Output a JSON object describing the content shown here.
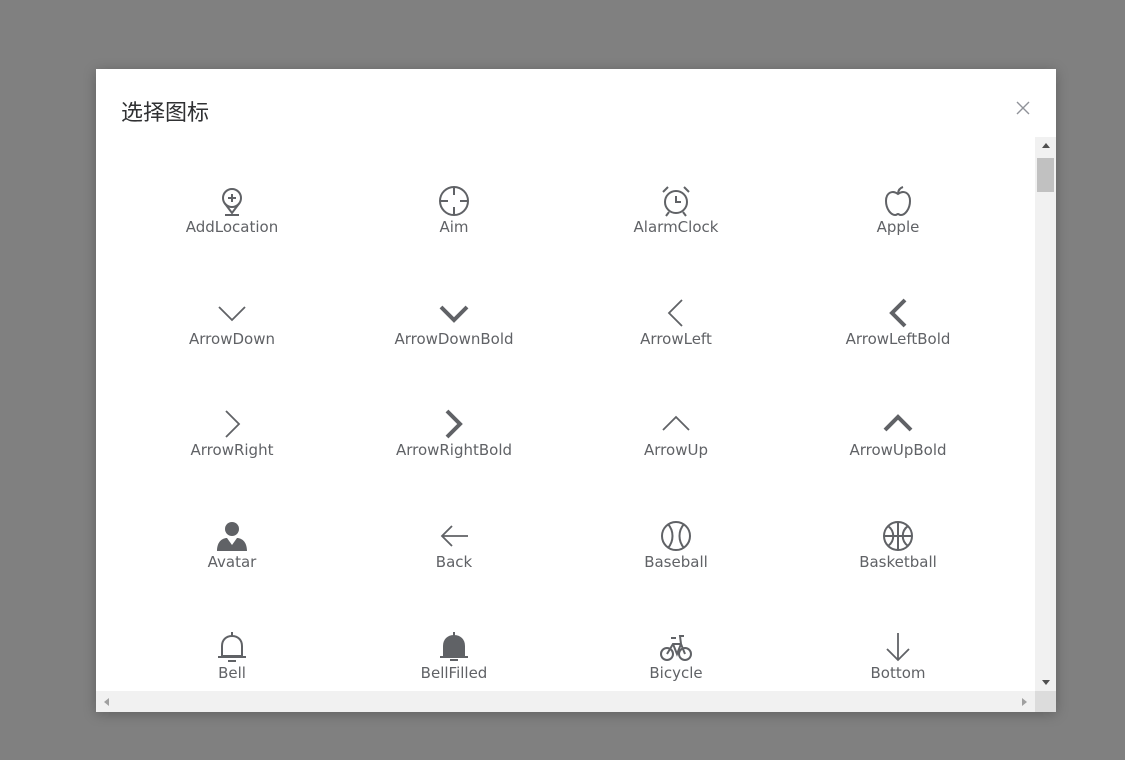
{
  "dialog": {
    "title": "选择图标"
  },
  "icons": [
    {
      "name": "AddLocation",
      "icon": "add-location-icon"
    },
    {
      "name": "Aim",
      "icon": "aim-icon"
    },
    {
      "name": "AlarmClock",
      "icon": "alarm-clock-icon"
    },
    {
      "name": "Apple",
      "icon": "apple-icon"
    },
    {
      "name": "ArrowDown",
      "icon": "arrow-down-icon"
    },
    {
      "name": "ArrowDownBold",
      "icon": "arrow-down-bold-icon"
    },
    {
      "name": "ArrowLeft",
      "icon": "arrow-left-icon"
    },
    {
      "name": "ArrowLeftBold",
      "icon": "arrow-left-bold-icon"
    },
    {
      "name": "ArrowRight",
      "icon": "arrow-right-icon"
    },
    {
      "name": "ArrowRightBold",
      "icon": "arrow-right-bold-icon"
    },
    {
      "name": "ArrowUp",
      "icon": "arrow-up-icon"
    },
    {
      "name": "ArrowUpBold",
      "icon": "arrow-up-bold-icon"
    },
    {
      "name": "Avatar",
      "icon": "avatar-icon"
    },
    {
      "name": "Back",
      "icon": "back-icon"
    },
    {
      "name": "Baseball",
      "icon": "baseball-icon"
    },
    {
      "name": "Basketball",
      "icon": "basketball-icon"
    },
    {
      "name": "Bell",
      "icon": "bell-icon"
    },
    {
      "name": "BellFilled",
      "icon": "bell-filled-icon"
    },
    {
      "name": "Bicycle",
      "icon": "bicycle-icon"
    },
    {
      "name": "Bottom",
      "icon": "bottom-icon"
    }
  ],
  "colors": {
    "overlay": "#808080",
    "icon": "#606266",
    "title": "#303133",
    "scrollbar_track": "#f1f1f1",
    "scrollbar_thumb": "#c1c1c1"
  }
}
